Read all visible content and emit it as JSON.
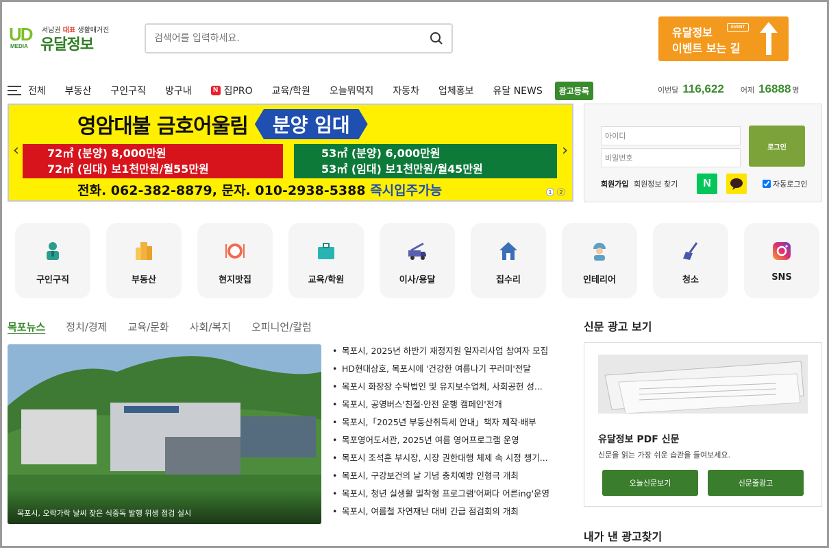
{
  "header": {
    "logo": {
      "mark": "UD",
      "media": "MEDIA",
      "tag_pre": "서남권 ",
      "tag_em": "대표",
      "tag_post": " 생활매거진",
      "name": "유달정보"
    },
    "search": {
      "placeholder": "검색어를 입력하세요."
    },
    "event_banner": {
      "line1": "유달정보",
      "line2": "이벤트 보는 길",
      "badge": "EVENT"
    }
  },
  "nav": {
    "all": "전체",
    "items": [
      "부동산",
      "구인구직",
      "방구내",
      "집PRO",
      "교육/학원",
      "오늘뭐먹지",
      "자동차",
      "업체홍보",
      "유달 NEWS"
    ],
    "npro_badge": "N",
    "ad_register": "광고등록"
  },
  "visits": {
    "month_label": "이번달",
    "month_count": "116,622",
    "yesterday_label": "어제",
    "yesterday_count": "16888",
    "unit": "명"
  },
  "main_banner": {
    "title": "영암대불 금호어울림",
    "title_badge": "분양 임대",
    "red_line1": "72㎡ (분양) 8,000만원",
    "red_line2": "72㎡ (임대) 보1천만원/월55만원",
    "green_line1": "53㎡ (분양) 6,000만원",
    "green_line2": "53㎡ (임대) 보1천만원/월45만원",
    "contact": "전화. 062-382-8879, 문자. 010-2938-5388 ",
    "contact_em": "즉시입주가능",
    "prev": "‹",
    "next": "›",
    "page1": "1",
    "page2": "2"
  },
  "login": {
    "id_placeholder": "아이디",
    "pw_placeholder": "비밀번호",
    "login_button": "로그인",
    "join": "회원가입",
    "find": "회원정보 찾기",
    "naver": "N",
    "auto_login": "자동로그인"
  },
  "categories": [
    "구인구직",
    "부동산",
    "현지맛집",
    "교육/학원",
    "이사/용달",
    "집수리",
    "인테리어",
    "청소",
    "SNS"
  ],
  "news": {
    "tabs": [
      "목포뉴스",
      "정치/경제",
      "교육/문화",
      "사회/복지",
      "오피니언/칼럼"
    ],
    "photo_caption": "목포시, 오락가락 날씨 잦은 식중독 발행 위생 점검 실시",
    "items": [
      "목포시, 2025년 하반기 재정지원 일자리사업 참여자 모집",
      "HD현대삼호, 목포시에 '건강한 여름나기 꾸러미'전달",
      "목포시 화장장 수탁법인 및 유지보수업체, 사회공헌 성...",
      "목포시, 공영버스'친절·안전 운행 캠페인'전개",
      "목포시,「2025년 부동산취득세 안내」책자 제작·배부",
      "목포영어도서관, 2025년 여름 영어프로그램 운영",
      "목포시 조석훈 부시장, 시장 권한대행 체제 속 시정 챙기...",
      "목포시, 구강보건의 날 기념 충치예방 인형극 개최",
      "목포시, 청년 실생활 밀착형 프로그램'어쩌다 어른ing'운영",
      "목포시, 여름철 자연재난 대비 긴급 점검회의 개최"
    ]
  },
  "newspaper": {
    "section_title": "신문 광고 보기",
    "heading": "유달정보 PDF 신문",
    "sub": "신문을 읽는 가장 쉬운 습관을 들여보세요.",
    "btn_today": "오늘신문보기",
    "btn_ad": "신문줄광고"
  },
  "my_ad": {
    "title": "내가 낸 광고찾기"
  },
  "colors": {
    "brand_green": "#3a8a2e",
    "event_orange": "#f39a1e",
    "banner_yellow": "#ffef00"
  }
}
